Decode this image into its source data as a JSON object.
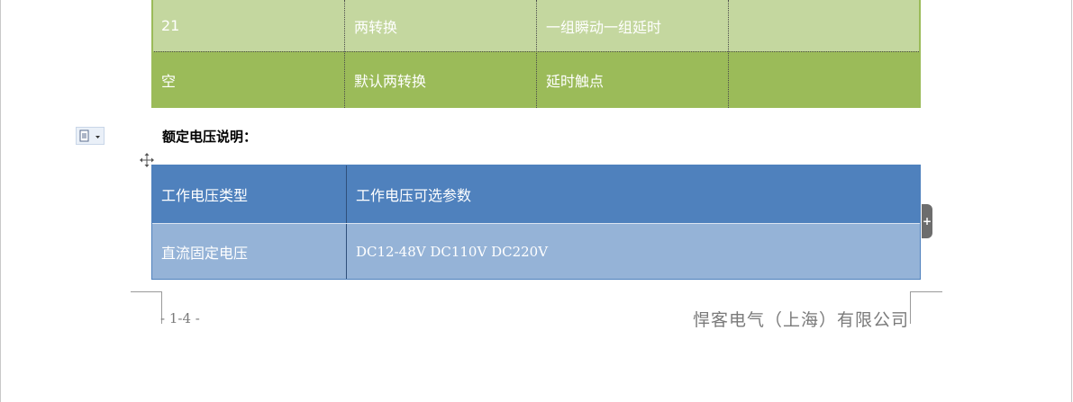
{
  "relay_table": {
    "rows": [
      {
        "cells": [
          "21",
          "两转换",
          "一组瞬动一组延时",
          ""
        ]
      },
      {
        "cells": [
          "空",
          "默认两转换",
          "延时触点",
          ""
        ]
      }
    ]
  },
  "section": {
    "heading": "额定电压说明："
  },
  "voltage_table": {
    "headers": [
      "工作电压类型",
      "工作电压可选参数"
    ],
    "rows": [
      {
        "cells": [
          "直流固定电压",
          "DC12-48V DC110V DC220V"
        ]
      }
    ]
  },
  "footer": {
    "page_number": "- 1-4 -",
    "company": "悍客电气（上海）有限公司"
  },
  "colors": {
    "green_light": "#c4d79f",
    "green_dark": "#9bbb59",
    "blue_header": "#4f81bd",
    "blue_body": "#95b3d7"
  },
  "icons": [
    "paste-options-icon",
    "table-move-icon",
    "add-row-icon"
  ]
}
